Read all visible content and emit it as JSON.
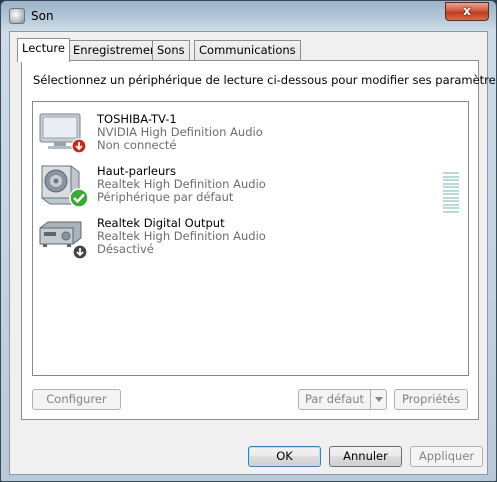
{
  "window": {
    "title": "Son",
    "close_label": "x"
  },
  "tabs": [
    {
      "label": "Lecture",
      "active": true
    },
    {
      "label": "Enregistrement",
      "active": false
    },
    {
      "label": "Sons",
      "active": false
    },
    {
      "label": "Communications",
      "active": false
    }
  ],
  "instruction": "Sélectionnez un périphérique de lecture ci-dessous pour modifier ses paramètres :",
  "devices": [
    {
      "name": "TOSHIBA-TV-1",
      "driver": "NVIDIA High Definition Audio",
      "status": "Non connecté",
      "icon": "tv-monitor-icon",
      "badge": "disconnected-badge-icon"
    },
    {
      "name": "Haut-parleurs",
      "driver": "Realtek High Definition Audio",
      "status": "Périphérique par défaut",
      "icon": "speaker-icon",
      "badge": "default-checkmark-icon"
    },
    {
      "name": "Realtek Digital Output",
      "driver": "Realtek High Definition Audio",
      "status": "Désactivé",
      "icon": "digital-output-receiver-icon",
      "badge": "disabled-badge-icon"
    }
  ],
  "level_meter": {
    "level": 0.0,
    "bars": 12,
    "color": "#b8dadb"
  },
  "buttons": {
    "configure": "Configurer",
    "set_default": "Par défaut",
    "properties": "Propriétés",
    "ok": "OK",
    "cancel": "Annuler",
    "apply": "Appliquer"
  },
  "colors": {
    "close_button": "#c03c1f",
    "default_badge": "#3aa935",
    "disabled_badge": "#444444",
    "disconnected_badge": "#c62a1e"
  }
}
